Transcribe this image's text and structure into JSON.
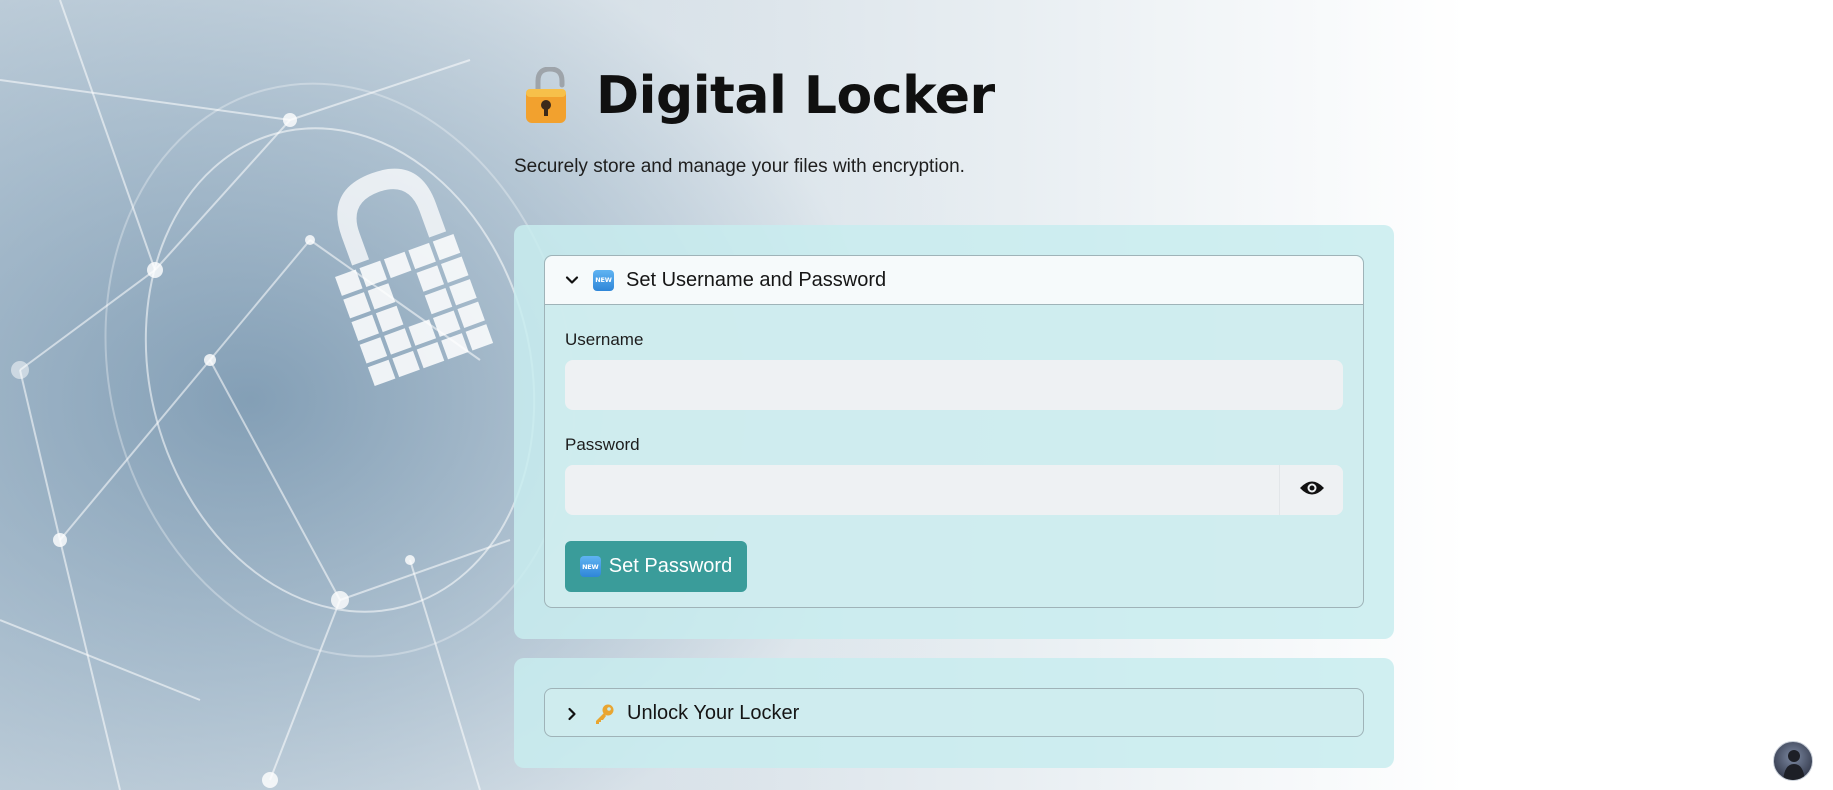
{
  "app": {
    "title": "Digital Locker",
    "subtitle": "Securely store and manage your files with encryption."
  },
  "setup_section": {
    "header_label": "Set Username and Password",
    "header_icon": "new-badge-icon",
    "expanded": true,
    "username_label": "Username",
    "username_value": "",
    "password_label": "Password",
    "password_value": "",
    "submit_label": "Set Password"
  },
  "unlock_section": {
    "header_label": "Unlock Your Locker",
    "header_icon": "key-icon",
    "expanded": false
  },
  "badge_text": "NEW",
  "colors": {
    "accent": "#3a9c9a",
    "panel_bg": "#c8ecee",
    "input_bg": "#eef1f3"
  }
}
